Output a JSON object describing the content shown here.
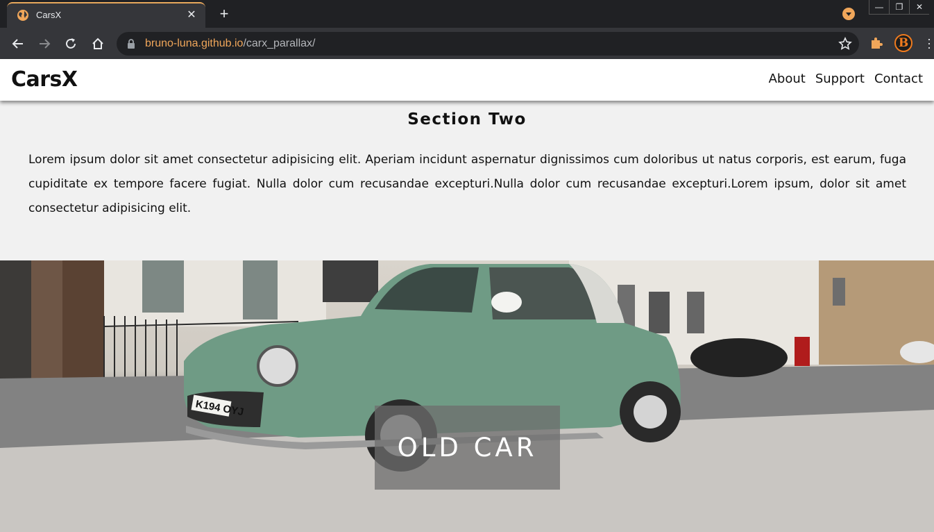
{
  "browser": {
    "tab_title": "CarsX",
    "new_tab_symbol": "+",
    "close_symbol": "✕",
    "url_host": "bruno-luna.github.io",
    "url_path": "/carx_parallax/",
    "extension_letter": "B",
    "window_controls": [
      "—",
      "❐",
      "✕"
    ],
    "icons": [
      "globe-icon",
      "back-arrow-icon",
      "forward-arrow-icon",
      "reload-icon",
      "home-icon",
      "lock-icon",
      "star-icon",
      "puzzle-icon",
      "kebab-menu-icon"
    ],
    "accent_color": "#f0a65a"
  },
  "site": {
    "logo": "CarsX",
    "nav": [
      "About",
      "Support",
      "Contact"
    ]
  },
  "section_two": {
    "title": "Section Two",
    "body": "Lorem ipsum dolor sit amet consectetur adipisicing elit. Aperiam incidunt aspernatur dignissimos cum doloribus ut natus corporis, est earum, fuga cupiditate ex tempore facere fugiat. Nulla dolor cum recusandae excepturi.Nulla dolor cum recusandae excepturi.Lorem ipsum, dolor sit amet consectetur adipisicing elit."
  },
  "hero": {
    "label": "OLD CAR",
    "plate_text": "K194 OYJ"
  }
}
